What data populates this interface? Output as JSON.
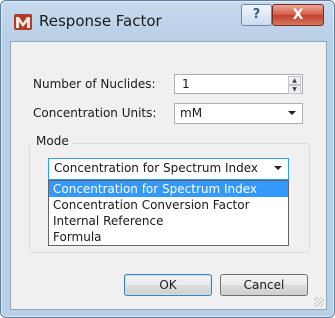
{
  "window": {
    "title": "Response Factor",
    "help_label": "?",
    "close_label": "X"
  },
  "form": {
    "nuclides_label": "Number of Nuclides:",
    "nuclides_value": "1",
    "units_label": "Concentration Units:",
    "units_value": "mM"
  },
  "mode": {
    "group_title": "Mode",
    "selected": "Concentration for Spectrum Index",
    "options": [
      "Concentration for Spectrum Index",
      "Concentration Conversion Factor",
      "Internal Reference",
      "Formula"
    ]
  },
  "buttons": {
    "ok": "OK",
    "cancel": "Cancel"
  },
  "icons": {
    "app": "response-factor-app-icon",
    "help": "help-icon",
    "close": "close-icon"
  },
  "colors": {
    "selection": "#3399ff",
    "close_button": "#c2402a"
  }
}
